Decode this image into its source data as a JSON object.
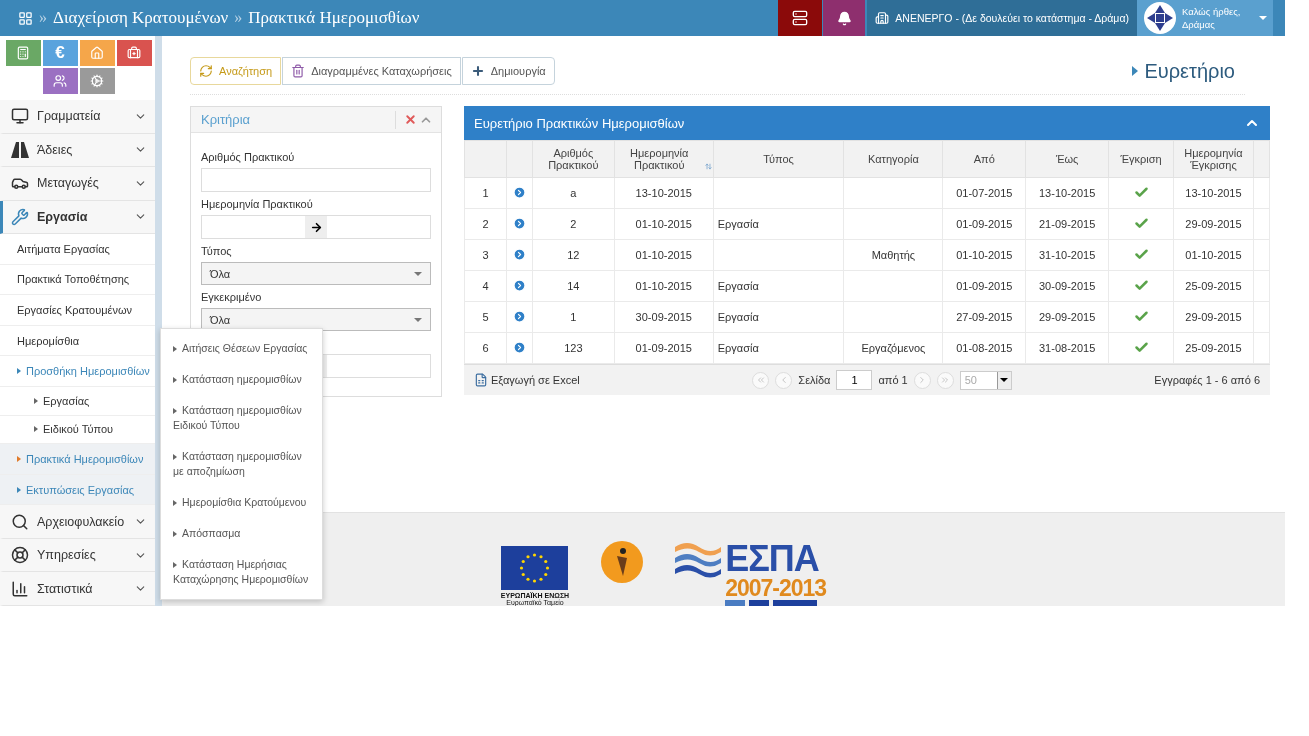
{
  "header": {
    "separator": "»",
    "breadcrumbs": [
      "Διαχείριση Κρατουμένων",
      "Πρακτικά Ημερομισθίων"
    ],
    "store_status": "ΑΝΕΝΕΡΓΟ - (Δε δουλεύει το κατάστημα - Δράμα)",
    "greeting": "Καλώς ήρθες,",
    "user": "Δράμας"
  },
  "shortcuts": [
    {
      "color": "#6aa865"
    },
    {
      "color": "#5aa3dd",
      "label": "€"
    },
    {
      "color": "#f5a64a"
    },
    {
      "color": "#d9534f"
    },
    {
      "color": "#9b70c2"
    },
    {
      "color": "#9a9a9a"
    }
  ],
  "sidebar": {
    "items": [
      {
        "label": "Γραμματεία",
        "selected": false
      },
      {
        "label": "Άδειες",
        "selected": false
      },
      {
        "label": "Μεταγωγές",
        "selected": false
      },
      {
        "label": "Εργασία",
        "selected": true,
        "children": [
          {
            "label": "Αιτήματα Εργασίας",
            "selected": false
          },
          {
            "label": "Πρακτικά Τοποθέτησης",
            "selected": false
          },
          {
            "label": "Εργασίες Κρατουμένων",
            "selected": false
          },
          {
            "label": "Ημερομίσθια",
            "selected": false
          },
          {
            "label": "Προσθήκη Ημερομισθίων",
            "selected": false,
            "expanded": true,
            "children": [
              {
                "label": "Εργασίας"
              },
              {
                "label": "Ειδικού Τύπου"
              }
            ]
          },
          {
            "label": "Πρακτικά Ημερομισθίων",
            "selected": true
          },
          {
            "label": "Εκτυπώσεις Εργασίας",
            "selected": false,
            "expanded": true,
            "flyout": [
              {
                "label": "Αιτήσεις Θέσεων Εργασίας"
              },
              {
                "label": "Κατάσταση ημερομισθίων"
              },
              {
                "label": "Κατάσταση ημερομισθίων Ειδικού Τύπου"
              },
              {
                "label": "Κατάσταση ημερομισθίων με αποζημίωση"
              },
              {
                "label": "Ημερομίσθια Κρατούμενου"
              },
              {
                "label": "Απόσπασμα"
              },
              {
                "label": "Κατάσταση Ημερήσιας Καταχώρησης Ημερομισθίων"
              }
            ]
          }
        ]
      },
      {
        "label": "Αρχειοφυλακείο",
        "selected": false
      },
      {
        "label": "Υπηρεσίες",
        "selected": false
      },
      {
        "label": "Στατιστικά",
        "selected": false
      }
    ]
  },
  "toolbar": [
    "Αναζήτηση",
    "Διαγραμμένες Καταχωρήσεις",
    "Δημιουργία"
  ],
  "page_title": "Ευρετήριο",
  "criteria": {
    "title": "Κριτήρια",
    "fields": [
      {
        "kind": "text",
        "label": "Αριθμός Πρακτικού"
      },
      {
        "kind": "range",
        "label": "Ημερομηνία Πρακτικού"
      },
      {
        "kind": "select",
        "label": "Τύπος",
        "value": "Όλα"
      },
      {
        "kind": "select",
        "label": "Εγκεκριμένο",
        "value": "Όλα"
      },
      {
        "kind": "range"
      }
    ]
  },
  "grid": {
    "title": "Ευρετήριο Πρακτικών Ημερομισθίων",
    "columns": [
      {
        "label": "Αριθμός Πρακτικού",
        "sorted": false
      },
      {
        "label": "Ημερομηνία Πρακτικού",
        "sorted": true
      },
      {
        "label": "Τύπος",
        "sorted": false
      },
      {
        "label": "Κατηγορία",
        "sorted": false
      },
      {
        "label": "Από",
        "sorted": false
      },
      {
        "label": "Έως",
        "sorted": false
      },
      {
        "label": "Έγκριση",
        "sorted": false
      },
      {
        "label": "Ημερομηνία Έγκρισης",
        "sorted": false
      }
    ],
    "rows": [
      {
        "index": "1",
        "number": "a",
        "date": "13-10-2015",
        "from": "01-07-2015",
        "to": "13-10-2015",
        "approved": true,
        "approval_date": "13-10-2015"
      },
      {
        "index": "2",
        "number": "2",
        "date": "01-10-2015",
        "type": "Εργασία",
        "from": "01-09-2015",
        "to": "21-09-2015",
        "approved": true,
        "approval_date": "29-09-2015"
      },
      {
        "index": "3",
        "number": "12",
        "date": "01-10-2015",
        "category": "Μαθητής",
        "from": "01-10-2015",
        "to": "31-10-2015",
        "approved": true,
        "approval_date": "01-10-2015"
      },
      {
        "index": "4",
        "number": "14",
        "date": "01-10-2015",
        "type": "Εργασία",
        "from": "01-09-2015",
        "to": "30-09-2015",
        "approved": true,
        "approval_date": "25-09-2015"
      },
      {
        "index": "5",
        "number": "1",
        "date": "30-09-2015",
        "type": "Εργασία",
        "from": "27-09-2015",
        "to": "29-09-2015",
        "approved": true,
        "approval_date": "29-09-2015"
      },
      {
        "index": "6",
        "number": "123",
        "date": "01-09-2015",
        "type": "Εργασία",
        "category": "Εργαζόμενος",
        "from": "01-08-2015",
        "to": "31-08-2015",
        "approved": true,
        "approval_date": "25-09-2015"
      }
    ],
    "footer": {
      "export": "Εξαγωγή σε Excel",
      "page_label": "Σελίδα",
      "page": "1",
      "page_of": "από 1",
      "page_size": "50",
      "records": "Εγγραφές 1 - 6 από 6"
    }
  },
  "footer": {
    "eu_title": "ΕΥΡΩΠΑΪΚΗ ΕΝΩΣΗ",
    "eu_subtitle": "Ευρωπαϊκό Ταμείο",
    "espa": "ΕΣΠΑ",
    "espa_years": "2007-2013"
  }
}
